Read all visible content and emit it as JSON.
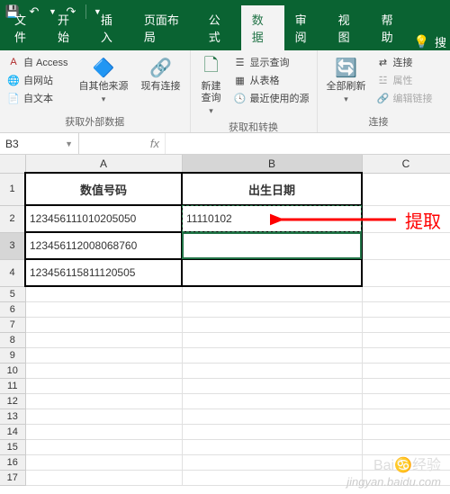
{
  "qat": {
    "save": "💾",
    "undo": "↶",
    "redo": "↷"
  },
  "tabs": {
    "file": "文件",
    "home": "开始",
    "insert": "插入",
    "layout": "页面布局",
    "formulas": "公式",
    "data": "数据",
    "review": "审阅",
    "view": "视图",
    "help": "帮助"
  },
  "ribbon": {
    "ext_access": "自 Access",
    "ext_web": "自网站",
    "ext_text": "自文本",
    "ext_other": "自其他来源",
    "ext_existing": "现有连接",
    "ext_label": "获取外部数据",
    "new_query": "新建\n查询",
    "show_query": "显示查询",
    "from_table": "从表格",
    "recent": "最近使用的源",
    "transform_label": "获取和转换",
    "refresh_all": "全部刷新",
    "conn": "连接",
    "props": "属性",
    "edit_links": "编辑链接",
    "conn_label": "连接"
  },
  "namebox": "B3",
  "columns": [
    "A",
    "B",
    "C"
  ],
  "col_widths": {
    "A": 174,
    "B": 200,
    "C": 98
  },
  "headers": {
    "a": "数值号码",
    "b": "出生日期"
  },
  "rows": [
    {
      "a": "123456111010205050",
      "b": "11110102"
    },
    {
      "a": "123456112008068760",
      "b": ""
    },
    {
      "a": "123456115811120505",
      "b": ""
    }
  ],
  "annotation": "提取",
  "watermark_main": "Bai♋经验",
  "watermark_sub": "jingyan.baidu.com",
  "chart_data": {
    "type": "table",
    "title": "",
    "columns": [
      "数值号码",
      "出生日期"
    ],
    "rows": [
      [
        "123456111010205050",
        "11110102"
      ],
      [
        "123456112008068760",
        ""
      ],
      [
        "123456115811120505",
        ""
      ]
    ]
  }
}
